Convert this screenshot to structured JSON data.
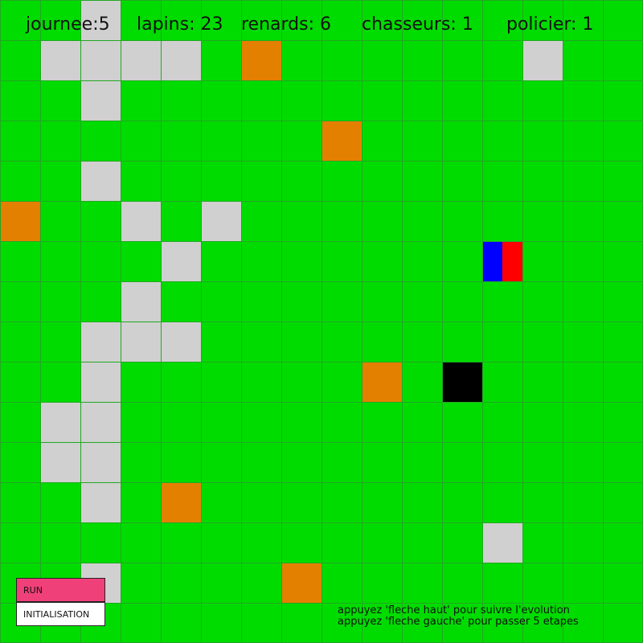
{
  "stats": {
    "day": "journee:5",
    "rabbits": "lapins: 23",
    "foxes": "renards: 6",
    "hunters": "chasseurs: 1",
    "policemen": "policier: 1"
  },
  "buttons": {
    "run": "RUN",
    "init": "INITIALISATION"
  },
  "help": {
    "line1": "appuyez 'fleche haut' pour suivre l'evolution",
    "line2": "appuyez 'fleche gauche' pour passer 5 etapes"
  },
  "colors": {
    "grass": "#00dc00",
    "grid": "#22a822",
    "rabbit": "#d0d0d0",
    "fox": "#e48000",
    "hunter": "#000000",
    "police_left": "#0000ff",
    "police_right": "#ff0000",
    "run_button": "#f0407a"
  },
  "grid": {
    "columns": 16,
    "rows": 16,
    "rabbits": [
      [
        2,
        0
      ],
      [
        1,
        1
      ],
      [
        2,
        1
      ],
      [
        3,
        1
      ],
      [
        4,
        1
      ],
      [
        13,
        1
      ],
      [
        2,
        2
      ],
      [
        2,
        4
      ],
      [
        3,
        5
      ],
      [
        5,
        5
      ],
      [
        4,
        6
      ],
      [
        3,
        7
      ],
      [
        2,
        8
      ],
      [
        3,
        8
      ],
      [
        4,
        8
      ],
      [
        2,
        9
      ],
      [
        1,
        10
      ],
      [
        2,
        10
      ],
      [
        1,
        11
      ],
      [
        2,
        11
      ],
      [
        2,
        12
      ],
      [
        12,
        13
      ],
      [
        2,
        14
      ]
    ],
    "foxes": [
      [
        6,
        1
      ],
      [
        8,
        3
      ],
      [
        0,
        5
      ],
      [
        9,
        9
      ],
      [
        4,
        12
      ],
      [
        7,
        14
      ]
    ],
    "hunters": [
      [
        11,
        9
      ]
    ],
    "policemen": [
      [
        12,
        6
      ]
    ]
  }
}
